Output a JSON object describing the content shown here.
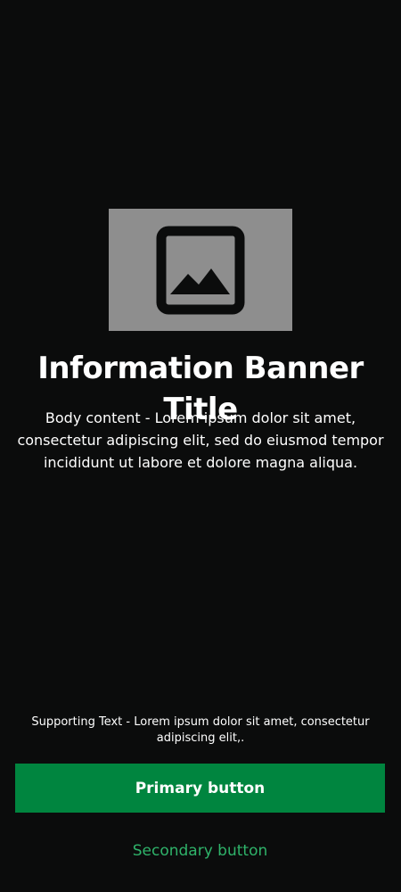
{
  "banner": {
    "image_icon": "image-placeholder-icon",
    "title": "Information Banner Title",
    "body": "Body content - Lorem ipsum dolor sit amet, consectetur adipiscing elit, sed do eiusmod tempor incididunt ut labore et dolore magna aliqua.",
    "supporting_text": "Supporting Text - Lorem ipsum dolor sit amet, consectetur adipiscing elit,.",
    "primary_button_label": "Primary button",
    "secondary_button_label": "Secondary button"
  },
  "colors": {
    "background": "#0b0c0c",
    "image_placeholder": "#8e8e8e",
    "primary": "#00853f",
    "secondary_text": "#2fb36a"
  }
}
